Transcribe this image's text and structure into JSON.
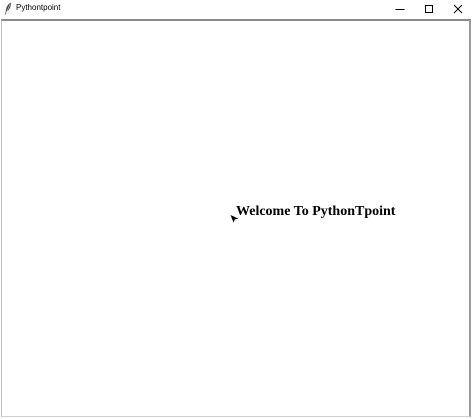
{
  "window": {
    "title": "Pythontpoint",
    "icons": {
      "app": "feather-icon",
      "minimize": "minimize-icon",
      "maximize": "maximize-icon",
      "close": "close-icon"
    }
  },
  "content": {
    "welcome_text": "Welcome To PythonTpoint"
  },
  "colors": {
    "background": "#ffffff",
    "text": "#000000",
    "border": "#8a8a8a"
  }
}
